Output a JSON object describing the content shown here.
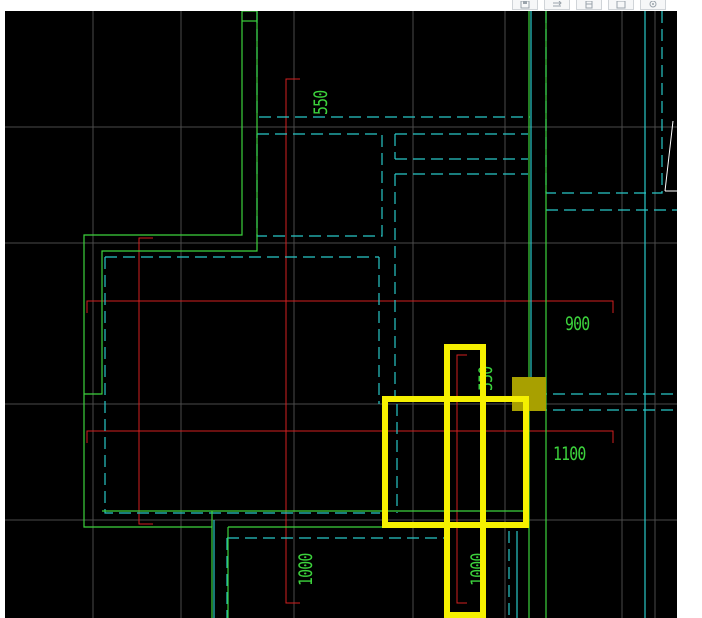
{
  "toolbar": {
    "buttons": [
      {
        "icon": "save-icon"
      },
      {
        "icon": "swap-icon"
      },
      {
        "icon": "layers-icon"
      },
      {
        "icon": "window-icon"
      },
      {
        "icon": "settings-icon"
      }
    ]
  },
  "drawing": {
    "dimensions": {
      "dim_550_top": "550",
      "dim_900": "900",
      "dim_550_mid": "550",
      "dim_1100": "1100",
      "dim_1000_left": "1000",
      "dim_1000_right": "1000"
    },
    "colors": {
      "background": "#000000",
      "grid": "#4a4a4a",
      "wall": "#3cd23c",
      "dashed": "#28c8c8",
      "axis": "#d22020",
      "highlight": "#f5f000",
      "marker": "#a8a000"
    }
  }
}
